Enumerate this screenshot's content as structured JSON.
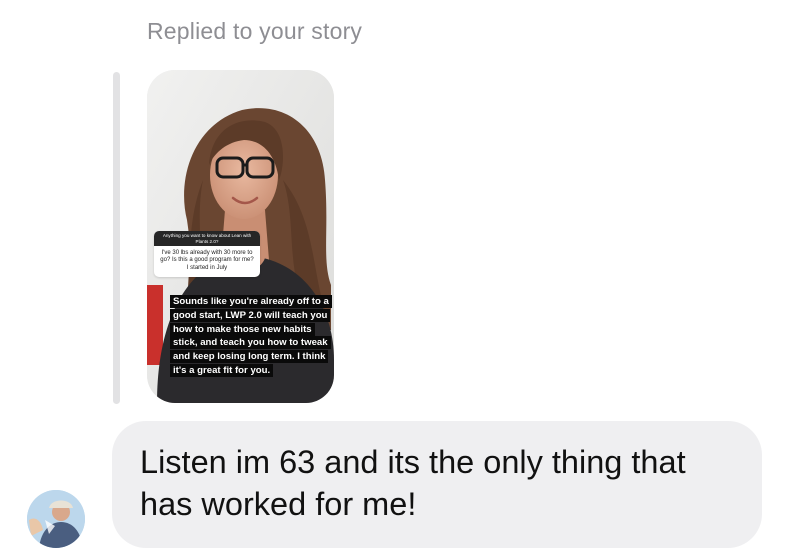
{
  "reply": {
    "label": "Replied to your story"
  },
  "story": {
    "question_header": "Anything you want to know about Lean with Plants 2.0?",
    "question_text": "I've 30 lbs already with 30 more to go? Is this a good program for me? I started in July",
    "answer_caption": "Sounds like you're already off to a good start, LWP 2.0 will teach you how to make those new habits stick, and teach you how to tweak and keep losing long term. I think it's a great fit for you."
  },
  "message": {
    "text": "Listen im 63 and its the only thing that has worked for me!"
  },
  "colors": {
    "bubble_bg": "#efeff1",
    "meta_text": "#8e8e93",
    "reply_bar": "#e2e2e4"
  }
}
